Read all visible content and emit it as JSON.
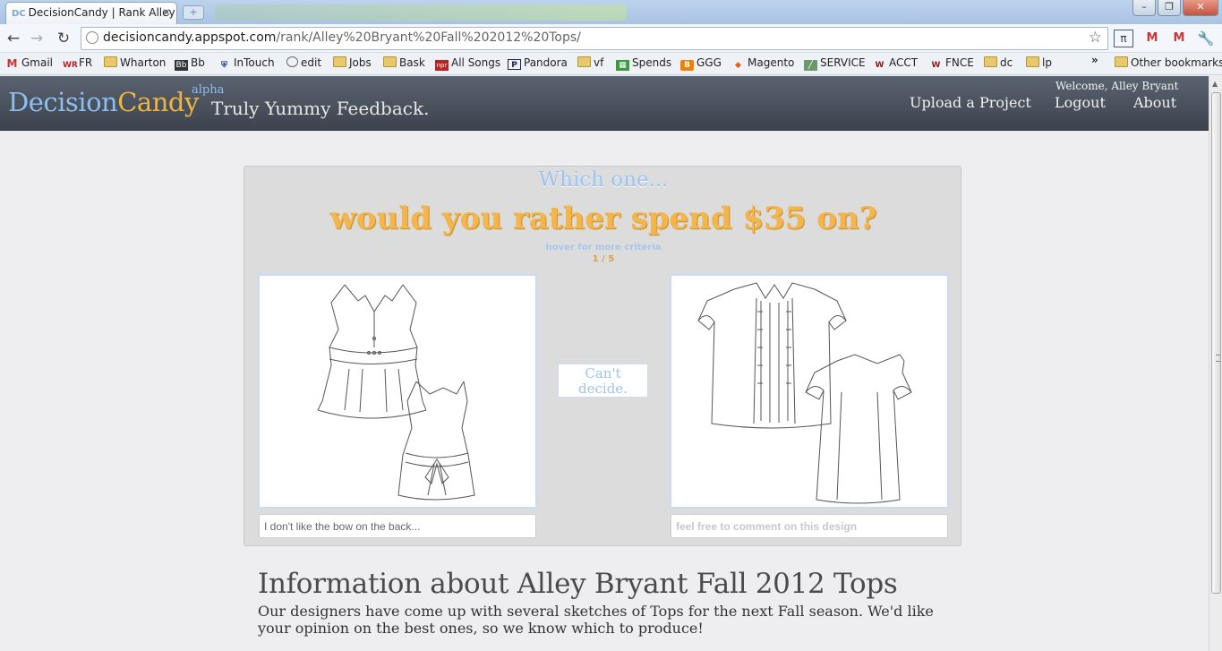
{
  "browser": {
    "tab_title": "DecisionCandy | Rank Alley",
    "tab_favicon": "DC",
    "url_host": "decisioncandy.appspot.com",
    "url_path": "/rank/Alley%20Bryant%20Fall%202012%20Tops/",
    "bookmarks": [
      {
        "label": "Gmail",
        "icon": "gmail-icon"
      },
      {
        "label": "FR",
        "icon": "wr-icon"
      },
      {
        "label": "Wharton",
        "icon": "folder-icon"
      },
      {
        "label": "Bb",
        "icon": "blackboard-icon"
      },
      {
        "label": "InTouch",
        "icon": "penn-icon"
      },
      {
        "label": "edit",
        "icon": "globe-icon"
      },
      {
        "label": "Jobs",
        "icon": "folder-icon"
      },
      {
        "label": "Bask",
        "icon": "folder-icon"
      },
      {
        "label": "All Songs",
        "icon": "npr-icon"
      },
      {
        "label": "Pandora",
        "icon": "pandora-icon"
      },
      {
        "label": "vf",
        "icon": "folder-icon"
      },
      {
        "label": "Spends",
        "icon": "spreadsheet-icon"
      },
      {
        "label": "GGG",
        "icon": "blogger-icon"
      },
      {
        "label": "Magento",
        "icon": "magento-icon"
      },
      {
        "label": "SERVICE",
        "icon": "service-icon"
      },
      {
        "label": "ACCT",
        "icon": "wharton-icon"
      },
      {
        "label": "FNCE",
        "icon": "wharton-icon"
      },
      {
        "label": "dc",
        "icon": "folder-icon"
      },
      {
        "label": "lp",
        "icon": "folder-icon"
      }
    ],
    "overflow": "»",
    "other_bookmarks": "Other bookmarks"
  },
  "header": {
    "logo_decision": "Decision",
    "logo_candy": "Candy",
    "alpha": "alpha",
    "tagline": "Truly Yummy Feedback.",
    "welcome": "Welcome, Alley Bryant",
    "nav": {
      "upload": "Upload a Project",
      "logout": "Logout",
      "about": "About"
    }
  },
  "rank": {
    "which": "Which one...",
    "question": "would you rather spend $35 on?",
    "hover": "hover for more criteria",
    "counter": "1 / 5",
    "cant_decide": "Can't decide.",
    "left_comment_value": "I don't like the bow on the back...",
    "right_comment_placeholder": "feel free to comment on this design"
  },
  "info": {
    "title": "Information about Alley Bryant Fall 2012 Tops",
    "body": "Our designers have come up with several sketches of Tops for the next Fall season. We'd like your opinion on the best ones, so we know which to produce!"
  },
  "colors": {
    "blue": "#8ebef0",
    "orange": "#f3b43f",
    "header": "#4a525d"
  }
}
